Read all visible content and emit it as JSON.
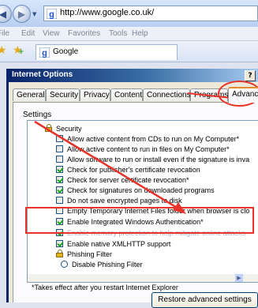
{
  "browser": {
    "address_url": "http://www.google.co.uk/",
    "menu": [
      "File",
      "Edit",
      "View",
      "Favorites",
      "Tools",
      "Help"
    ],
    "tab_title": "Google"
  },
  "dialog": {
    "title": "Internet Options",
    "help_label": "?",
    "tabs": [
      "General",
      "Security",
      "Privacy",
      "Content",
      "Connections",
      "Programs",
      "Advanced"
    ],
    "active_tab": "Advanced",
    "settings_label": "Settings",
    "settings": [
      {
        "type": "group",
        "label": "Security"
      },
      {
        "type": "checkbox",
        "checked": false,
        "label": "Allow active content from CDs to run on My Computer*"
      },
      {
        "type": "checkbox",
        "checked": false,
        "label": "Allow active content to run in files on My Computer*"
      },
      {
        "type": "checkbox",
        "checked": false,
        "label": "Allow software to run or install even if the signature is inva"
      },
      {
        "type": "checkbox",
        "checked": true,
        "label": "Check for publisher's certificate revocation"
      },
      {
        "type": "checkbox",
        "checked": true,
        "label": "Check for server certificate revocation*"
      },
      {
        "type": "checkbox",
        "checked": true,
        "label": "Check for signatures on downloaded programs"
      },
      {
        "type": "checkbox",
        "checked": false,
        "label": "Do not save encrypted pages to disk"
      },
      {
        "type": "checkbox",
        "checked": false,
        "label": "Empty Temporary Internet Files folder when browser is clo"
      },
      {
        "type": "checkbox",
        "checked": true,
        "label": "Enable Integrated Windows Authentication*"
      },
      {
        "type": "checkbox",
        "checked": true,
        "label": "Enable memory protection to help mitigate online attacks"
      },
      {
        "type": "checkbox",
        "checked": true,
        "label": "Enable native XMLHTTP support"
      },
      {
        "type": "subgroup",
        "label": "Phishing Filter"
      },
      {
        "type": "radio",
        "checked": false,
        "label": "Disable Phishing Filter"
      }
    ],
    "footnote": "*Takes effect after you restart Internet Explorer",
    "restore_button": "Restore advanced settings"
  },
  "colors": {
    "annotation": "#e8332a",
    "title_bar": "#0a246a",
    "check_mark": "#21a121"
  }
}
